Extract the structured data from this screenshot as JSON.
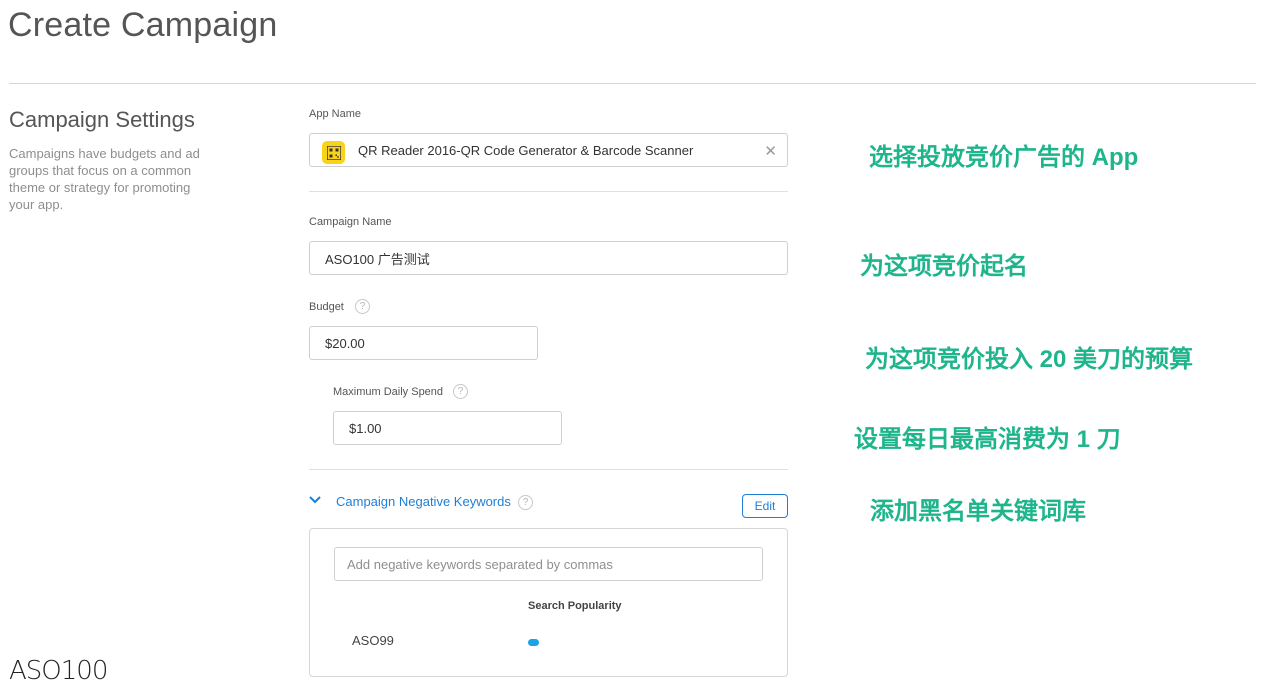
{
  "page": {
    "title": "Create Campaign"
  },
  "section": {
    "title": "Campaign Settings",
    "description": "Campaigns have budgets and ad groups that focus on a common theme or strategy for promoting your app."
  },
  "form": {
    "app_name_label": "App Name",
    "app_name_value": "QR Reader 2016-QR Code Generator & Barcode Scanner",
    "campaign_name_label": "Campaign Name",
    "campaign_name_value": "ASO100 广告测试",
    "budget_label": "Budget",
    "budget_value": "$20.00",
    "daily_spend_label": "Maximum Daily Spend",
    "daily_spend_value": "$1.00",
    "help_glyph": "?",
    "clear_glyph": "✕"
  },
  "negative_keywords": {
    "title": "Campaign Negative Keywords",
    "edit_label": "Edit",
    "placeholder": "Add negative keywords separated by commas",
    "column_header": "Search Popularity",
    "rows": [
      {
        "keyword": "ASO99",
        "popularity": 0.1
      }
    ]
  },
  "annotations": {
    "app": "选择投放竞价广告的 App",
    "name": "为这项竞价起名",
    "budget": "为这项竞价投入 20 美刀的预算",
    "daily": "设置每日最高消费为 1 刀",
    "keywords": "添加黑名单关键词库"
  },
  "watermark": {
    "text": "ASO100"
  },
  "colors": {
    "accent": "#1d7fd6",
    "annotation": "#1fb58c",
    "app_icon": "#f8d21b",
    "popularity_bar": "#1aa3e8"
  }
}
